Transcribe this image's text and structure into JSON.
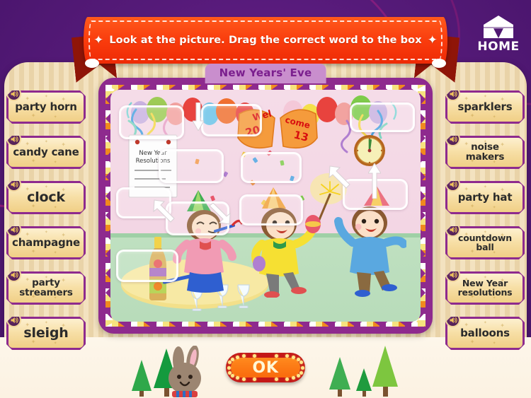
{
  "app": {
    "home_label": "HOME",
    "home_icon": "tent-icon"
  },
  "banner": {
    "instruction": "Look at the picture. Drag the correct word to the box",
    "left_star": "✦",
    "right_star": "✦"
  },
  "lesson": {
    "title": "New Years' Eve"
  },
  "scene": {
    "notepad_title_line1": "New Year",
    "notepad_title_line2": "Resolutions",
    "popper_left_top": "Wel",
    "popper_left_bottom": "20",
    "popper_right_top": "come",
    "popper_right_bottom": "13",
    "description": "Three children celebrating New Year's Eve with party horn, maracas and sparkler; champagne bottle and glasses on a table; balloons, streamers, confetti and a clock near midnight"
  },
  "word_cards": {
    "left": [
      {
        "label": "party horn",
        "lines": 1,
        "size": "normal",
        "speaker": "speaker-icon"
      },
      {
        "label": "candy cane",
        "lines": 1,
        "size": "normal",
        "speaker": "speaker-icon"
      },
      {
        "label": "clock",
        "lines": 1,
        "size": "big",
        "speaker": "speaker-icon"
      },
      {
        "label": "champagne",
        "lines": 1,
        "size": "normal",
        "speaker": "speaker-icon"
      },
      {
        "label": "party\nstreamers",
        "lines": 2,
        "size": "two-line",
        "speaker": "speaker-icon"
      },
      {
        "label": "sleigh",
        "lines": 1,
        "size": "big",
        "speaker": "speaker-icon"
      }
    ],
    "right": [
      {
        "label": "sparklers",
        "lines": 1,
        "size": "normal",
        "speaker": "speaker-icon"
      },
      {
        "label": "noise\nmakers",
        "lines": 2,
        "size": "two-line",
        "speaker": "speaker-icon"
      },
      {
        "label": "party hat",
        "lines": 1,
        "size": "normal",
        "speaker": "speaker-icon"
      },
      {
        "label": "countdown\nball",
        "lines": 2,
        "size": "small",
        "speaker": "speaker-icon"
      },
      {
        "label": "New Year\nresolutions",
        "lines": 2,
        "size": "small",
        "speaker": "speaker-icon"
      },
      {
        "label": "balloons",
        "lines": 1,
        "size": "normal",
        "speaker": "speaker-icon"
      }
    ]
  },
  "actions": {
    "ok_label": "OK"
  },
  "colors": {
    "background_purple": "#5b1a7a",
    "banner_red": "#f93a0c",
    "frame_purple": "#8e2a8e",
    "card_gold": "#f7dfa6",
    "title_purple": "#7b1f8e",
    "title_tab": "#c98ecd",
    "ok_red": "#c41818",
    "ok_orange": "#f96a0c"
  }
}
